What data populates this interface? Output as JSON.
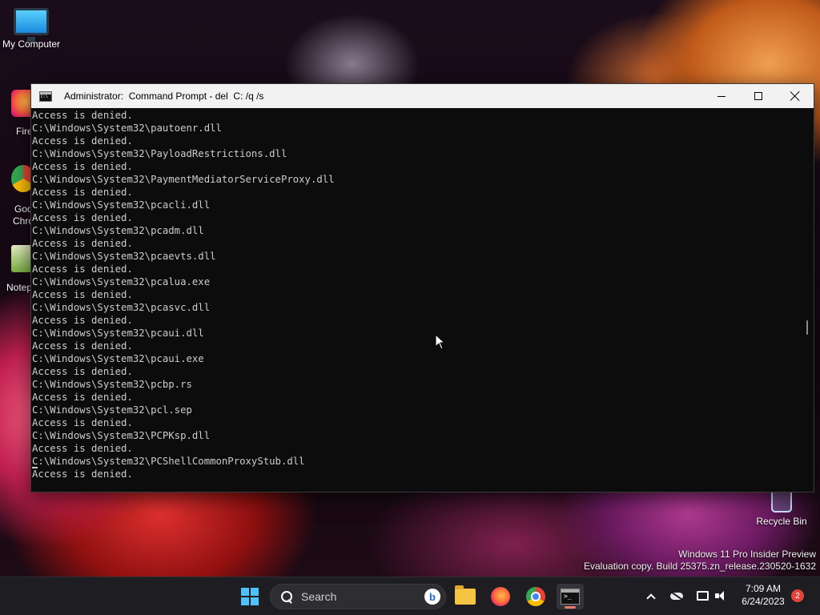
{
  "desktop": {
    "icons": [
      {
        "label": "My Computer"
      },
      {
        "label": "Fire"
      },
      {
        "label": "Goo"
      },
      {
        "label": "Chro"
      },
      {
        "label": "Notep"
      },
      {
        "label": "Recycle Bin"
      }
    ],
    "watermark": {
      "line1": "Windows 11 Pro Insider Preview",
      "line2": "Evaluation copy. Build 25375.zn_release.230520-1632"
    }
  },
  "window": {
    "title": "Administrator:  Command Prompt - del  C: /q /s",
    "lines": [
      "Access is denied.",
      "C:\\Windows\\System32\\pautoenr.dll",
      "Access is denied.",
      "C:\\Windows\\System32\\PayloadRestrictions.dll",
      "Access is denied.",
      "C:\\Windows\\System32\\PaymentMediatorServiceProxy.dll",
      "Access is denied.",
      "C:\\Windows\\System32\\pcacli.dll",
      "Access is denied.",
      "C:\\Windows\\System32\\pcadm.dll",
      "Access is denied.",
      "C:\\Windows\\System32\\pcaevts.dll",
      "Access is denied.",
      "C:\\Windows\\System32\\pcalua.exe",
      "Access is denied.",
      "C:\\Windows\\System32\\pcasvc.dll",
      "Access is denied.",
      "C:\\Windows\\System32\\pcaui.dll",
      "Access is denied.",
      "C:\\Windows\\System32\\pcaui.exe",
      "Access is denied.",
      "C:\\Windows\\System32\\pcbp.rs",
      "Access is denied.",
      "C:\\Windows\\System32\\pcl.sep",
      "Access is denied.",
      "C:\\Windows\\System32\\PCPKsp.dll",
      "Access is denied.",
      "C:\\Windows\\System32\\PCShellCommonProxyStub.dll",
      "Access is denied."
    ]
  },
  "taskbar": {
    "search_label": "Search",
    "bing_letter": "b",
    "clock": {
      "time": "7:09 AM",
      "date": "6/24/2023"
    },
    "notification_count": "2"
  }
}
